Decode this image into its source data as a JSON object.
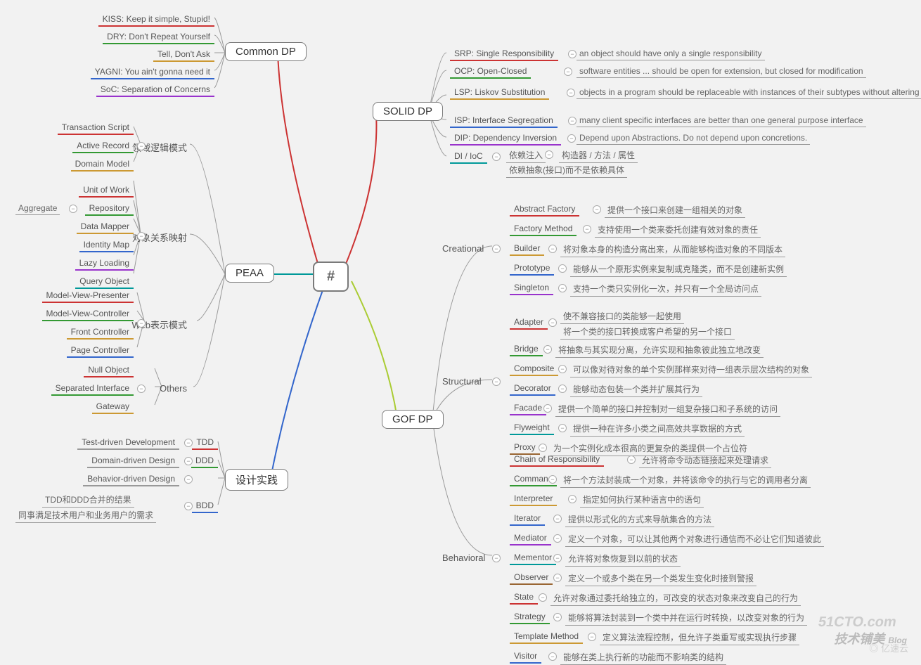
{
  "root": "#",
  "branches": {
    "common": {
      "label": "Common DP",
      "items": [
        {
          "t": "KISS: Keep it simple, Stupid!",
          "c": "#cc3333"
        },
        {
          "t": "DRY: Don't Repeat Yourself",
          "c": "#339933"
        },
        {
          "t": "Tell, Don't Ask",
          "c": "#cc9933"
        },
        {
          "t": "YAGNI: You ain't gonna need it",
          "c": "#3366cc"
        },
        {
          "t": "SoC: Separation of Concerns",
          "c": "#9933cc"
        }
      ]
    },
    "solid": {
      "label": "SOLID DP",
      "items": [
        {
          "t": "SRP: Single Responsibility",
          "d": "an object should have only a single responsibility",
          "c": "#cc3333"
        },
        {
          "t": "OCP: Open-Closed",
          "d": "software entities ... should be open for extension, but closed for modification",
          "c": "#339933"
        },
        {
          "t": "LSP: Liskov Substitution",
          "d": "objects in a program should be replaceable with instances of their subtypes without altering the correctness of that program",
          "c": "#cc9933"
        },
        {
          "t": "ISP: Interface Segregation",
          "d": "many client specific interfaces are better than one general purpose interface",
          "c": "#3366cc"
        },
        {
          "t": "DIP: Dependency Inversion",
          "d": "Depend upon Abstractions. Do not depend upon concretions.",
          "c": "#9933cc"
        },
        {
          "t": "DI / IoC",
          "c": "#009999",
          "sub": [
            {
              "t": "依赖注入",
              "d": "构造器 / 方法 / 属性"
            },
            {
              "t": "依赖抽象(接口)而不是依赖具体"
            }
          ]
        }
      ]
    },
    "gof": {
      "label": "GOF DP",
      "groups": [
        {
          "name": "Creational",
          "items": [
            {
              "t": "Abstract Factory",
              "d": "提供一个接口来创建一组相关的对象",
              "c": "#cc3333"
            },
            {
              "t": "Factory Method",
              "d": "支持使用一个类来委托创建有效对象的责任",
              "c": "#339933"
            },
            {
              "t": "Builder",
              "d": "将对象本身的构造分离出来，从而能够构造对象的不同版本",
              "c": "#cc9933"
            },
            {
              "t": "Prototype",
              "d": "能够从一个原形实例来复制或克隆类，而不是创建新实例",
              "c": "#3366cc"
            },
            {
              "t": "Singleton",
              "d": "支持一个类只实例化一次，并只有一个全局访问点",
              "c": "#9933cc"
            }
          ]
        },
        {
          "name": "Structural",
          "items": [
            {
              "t": "Adapter",
              "c": "#cc3333",
              "sub": [
                "使不兼容接口的类能够一起使用",
                "将一个类的接口转换成客户希望的另一个接口"
              ]
            },
            {
              "t": "Bridge",
              "d": "将抽象与其实现分离，允许实现和抽象彼此独立地改变",
              "c": "#339933"
            },
            {
              "t": "Composite",
              "d": "可以像对待对象的单个实例那样来对待一组表示层次结构的对象",
              "c": "#cc9933"
            },
            {
              "t": "Decorator",
              "d": "能够动态包装一个类并扩展其行为",
              "c": "#3366cc"
            },
            {
              "t": "Facade",
              "d": "提供一个简单的接口并控制对一组复杂接口和子系统的访问",
              "c": "#9933cc"
            },
            {
              "t": "Flyweight",
              "d": "提供一种在许多小类之间高效共享数据的方式",
              "c": "#009999"
            },
            {
              "t": "Proxy",
              "d": "为一个实例化成本很高的更复杂的类提供一个占位符",
              "c": "#996633"
            }
          ]
        },
        {
          "name": "Behavioral",
          "items": [
            {
              "t": "Chain of Responsibility",
              "d": "允许将命令动态链接起来处理请求",
              "c": "#cc3333"
            },
            {
              "t": "Command",
              "d": "将一个方法封装成一个对象，并将该命令的执行与它的调用者分离",
              "c": "#339933"
            },
            {
              "t": "Interpreter",
              "d": "指定如何执行某种语言中的语句",
              "c": "#cc9933"
            },
            {
              "t": "Iterator",
              "d": "提供以形式化的方式来导航集合的方法",
              "c": "#3366cc"
            },
            {
              "t": "Mediator",
              "d": "定义一个对象，可以让其他两个对象进行通信而不必让它们知道彼此",
              "c": "#9933cc"
            },
            {
              "t": "Mementor",
              "d": "允许将对象恢复到以前的状态",
              "c": "#009999"
            },
            {
              "t": "Observer",
              "d": "定义一个或多个类在另一个类发生变化时接到警报",
              "c": "#996633"
            },
            {
              "t": "State",
              "d": "允许对象通过委托给独立的，可改变的状态对象来改变自己的行为",
              "c": "#cc3333"
            },
            {
              "t": "Strategy",
              "d": "能够将算法封装到一个类中并在运行时转换，以改变对象的行为",
              "c": "#339933"
            },
            {
              "t": "Template Method",
              "d": "定义算法流程控制，但允许子类重写或实现执行步骤",
              "c": "#cc9933"
            },
            {
              "t": "Visitor",
              "d": "能够在类上执行新的功能而不影响类的结构",
              "c": "#3366cc"
            }
          ]
        }
      ]
    },
    "peaa": {
      "label": "PEAA",
      "groups": [
        {
          "name": "领域逻辑模式",
          "items": [
            {
              "t": "Transaction Script",
              "c": "#cc3333"
            },
            {
              "t": "Active Record",
              "c": "#339933"
            },
            {
              "t": "Domain Model",
              "c": "#cc9933"
            }
          ]
        },
        {
          "name": "对象关系映射",
          "items": [
            {
              "t": "Unit of Work",
              "c": "#cc3333"
            },
            {
              "t": "Repository",
              "d": "Aggregate",
              "c": "#339933"
            },
            {
              "t": "Data Mapper",
              "c": "#cc9933"
            },
            {
              "t": "Identity Map",
              "c": "#3366cc"
            },
            {
              "t": "Lazy Loading",
              "c": "#9933cc"
            },
            {
              "t": "Query Object",
              "c": "#009999"
            }
          ]
        },
        {
          "name": "Web表示模式",
          "items": [
            {
              "t": "Model-View-Presenter",
              "c": "#cc3333"
            },
            {
              "t": "Model-View-Controller",
              "c": "#339933"
            },
            {
              "t": "Front Controller",
              "c": "#cc9933"
            },
            {
              "t": "Page Controller",
              "c": "#3366cc"
            }
          ]
        },
        {
          "name": "Others",
          "items": [
            {
              "t": "Null Object",
              "c": "#cc3333"
            },
            {
              "t": "Separated Interface",
              "c": "#339933"
            },
            {
              "t": "Gateway",
              "c": "#cc9933"
            }
          ]
        }
      ]
    },
    "practice": {
      "label": "设计实践",
      "items": [
        {
          "t": "TDD",
          "d": "Test-driven Development",
          "c": "#cc3333"
        },
        {
          "t": "DDD",
          "d": "Domain-driven Design",
          "c": "#339933"
        },
        {
          "t": "",
          "d": "Behavior-driven Design",
          "c": "#cc9933"
        },
        {
          "t": "BDD",
          "c": "#3366cc",
          "sub": [
            "TDD和DDD合并的结果",
            "同事满足技术用户和业务用户的需求"
          ]
        }
      ]
    }
  },
  "watermark": {
    "line1": "51CTO.com",
    "line2": "技术铺美",
    "line3": "Blog",
    "line4": "亿速云"
  }
}
